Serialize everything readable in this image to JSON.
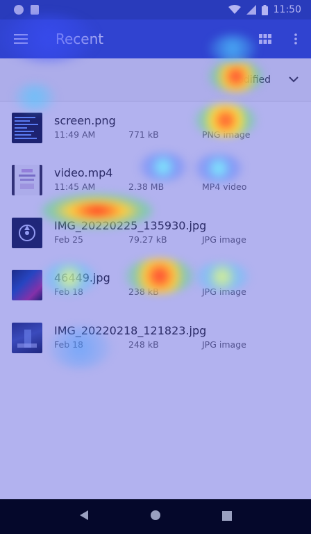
{
  "status_bar": {
    "time": "11:50"
  },
  "app_bar": {
    "title": "Recent"
  },
  "sort": {
    "label": "Modified"
  },
  "files": [
    {
      "name": "screen.png",
      "date": "11:49 AM",
      "size": "771 kB",
      "type": "PNG image"
    },
    {
      "name": "video.mp4",
      "date": "11:45 AM",
      "size": "2.38 MB",
      "type": "MP4 video"
    },
    {
      "name": "IMG_20220225_135930.jpg",
      "date": "Feb 25",
      "size": "79.27 kB",
      "type": "JPG image"
    },
    {
      "name": "46449.jpg",
      "date": "Feb 18",
      "size": "238 kB",
      "type": "JPG image"
    },
    {
      "name": "IMG_20220218_121823.jpg",
      "date": "Feb 18",
      "size": "248 kB",
      "type": "JPG image"
    }
  ],
  "icons": {
    "menu": "hamburger-menu-icon",
    "grid": "grid-view-icon",
    "more": "more-vert-icon",
    "sort_arrow": "chevron-down-icon",
    "back": "back-triangle-icon",
    "home": "home-circle-icon",
    "recents": "recents-square-icon"
  },
  "colors": {
    "status_bar": "#1e3aa6",
    "app_bar": "#2948c8",
    "nav_bar": "#05082b"
  }
}
